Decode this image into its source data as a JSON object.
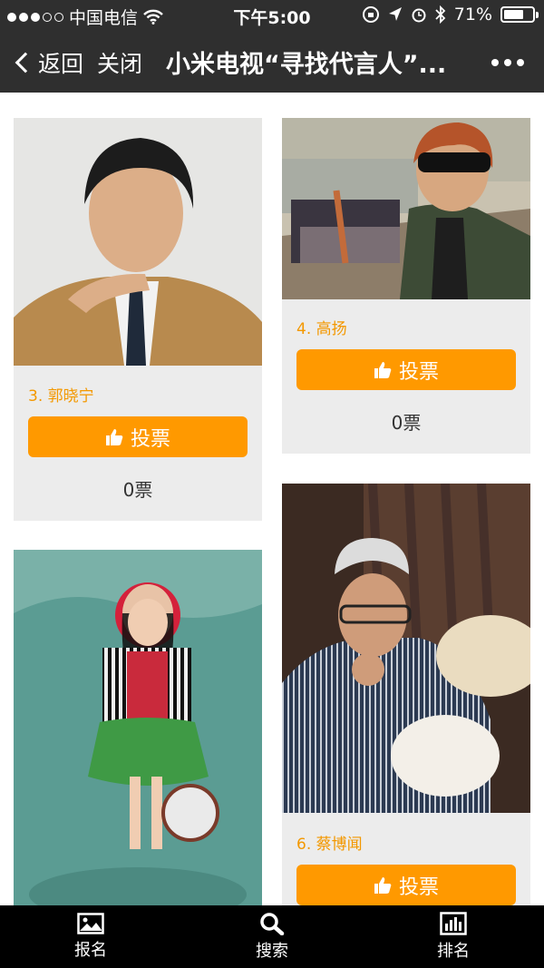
{
  "status_bar": {
    "carrier": "中国电信",
    "time": "下午5:00",
    "battery": "71%",
    "battery_level": 0.71,
    "signal_dots": [
      true,
      true,
      true,
      false,
      false
    ]
  },
  "nav": {
    "back_label": "返回",
    "close_label": "关闭",
    "title": "小米电视“寻找代言人”..."
  },
  "accent_color": "#ff9900",
  "name_color": "#f39800",
  "contestants": [
    {
      "name": "3. 郭晓宁",
      "vote_label": "投票",
      "votes": "0票"
    },
    {
      "name": "4. 高扬",
      "vote_label": "投票",
      "votes": "0票"
    },
    {
      "name": "",
      "vote_label": "",
      "votes": ""
    },
    {
      "name": "6. 蔡博闻",
      "vote_label": "投票",
      "votes": ""
    }
  ],
  "tabs": [
    {
      "label": "报名",
      "icon": "image-icon"
    },
    {
      "label": "搜索",
      "icon": "search-icon"
    },
    {
      "label": "排名",
      "icon": "bar-chart-icon"
    }
  ]
}
